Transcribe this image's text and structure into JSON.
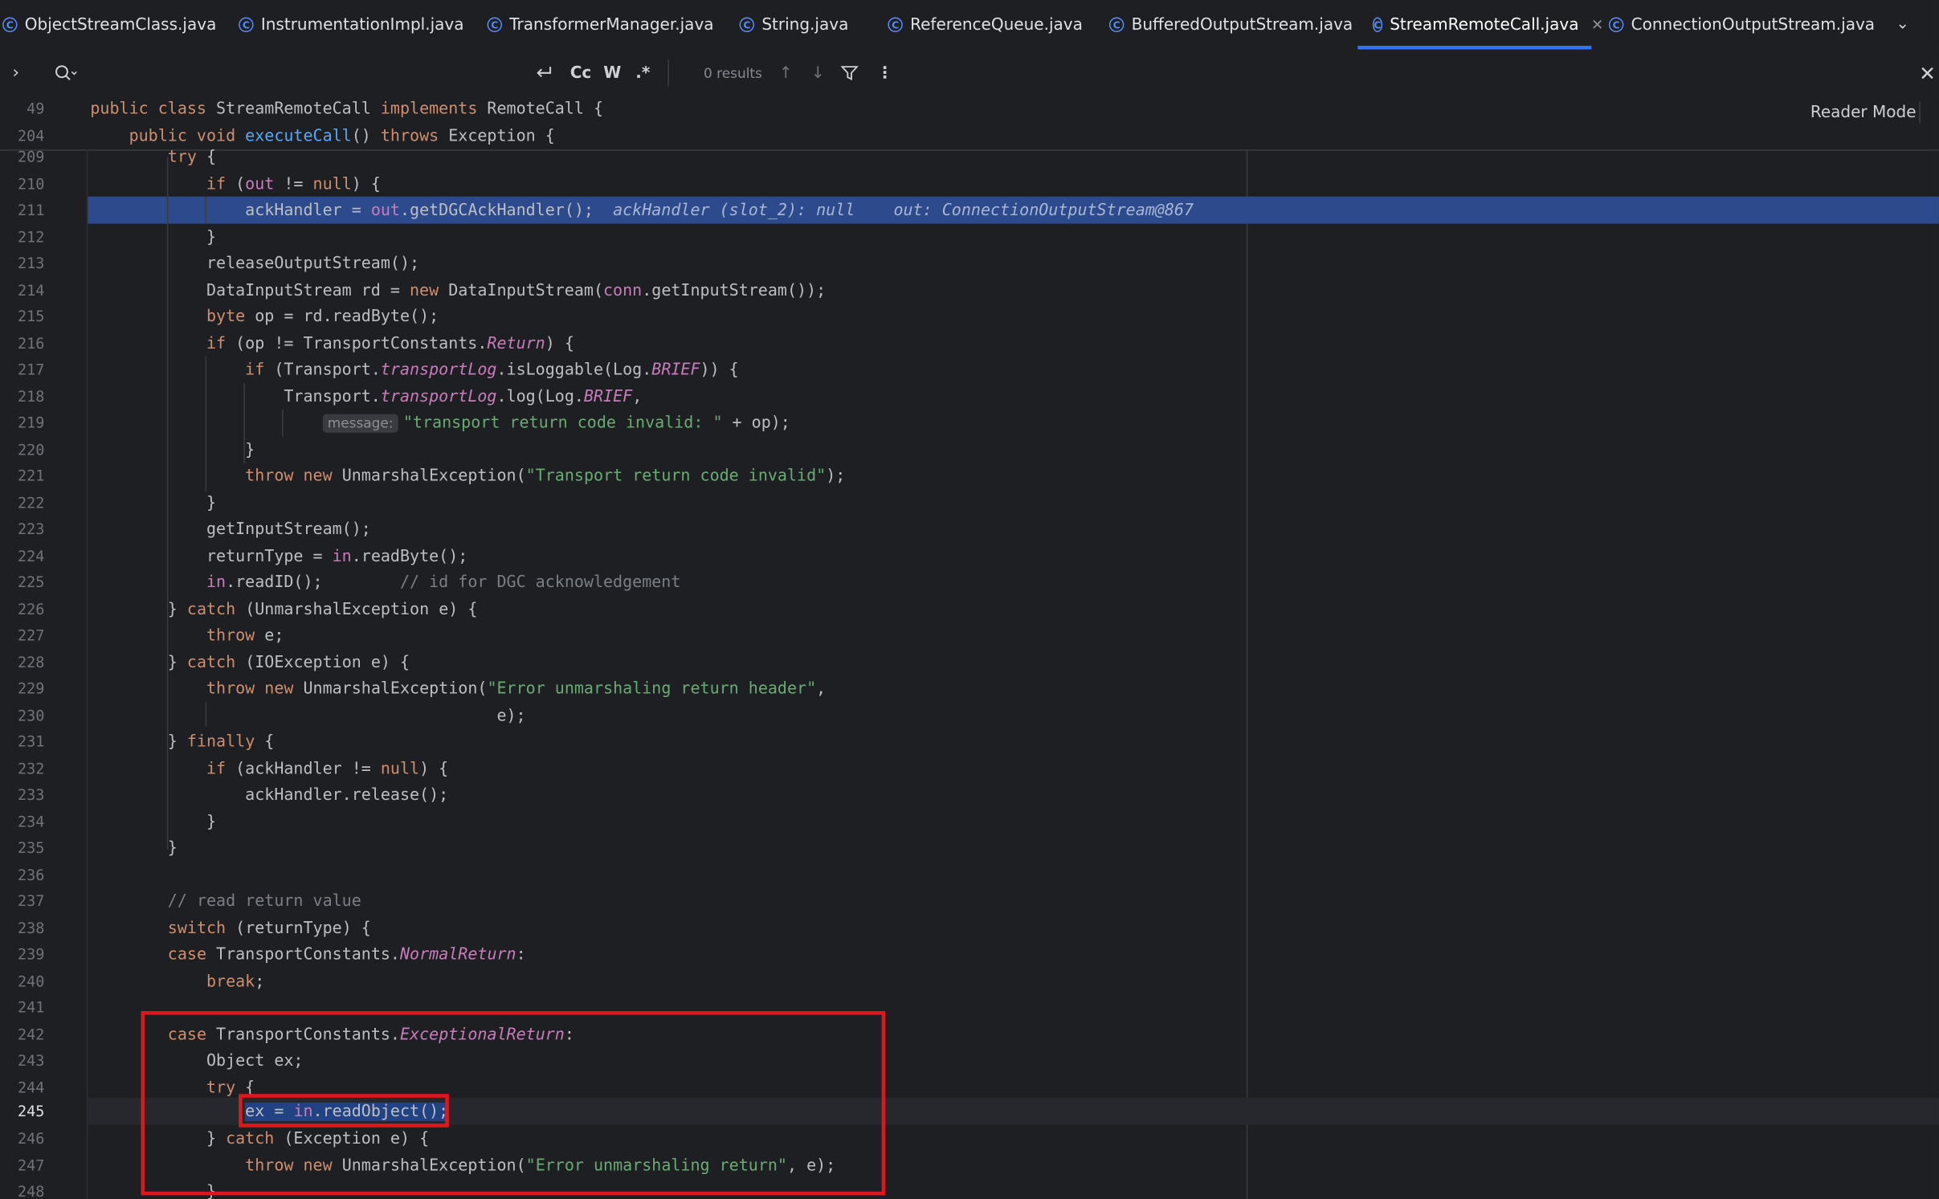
{
  "tabs": [
    {
      "label": "ObjectStreamClass.java",
      "icon": "class-icon"
    },
    {
      "label": "InstrumentationImpl.java",
      "icon": "class-icon"
    },
    {
      "label": "TransformerManager.java",
      "icon": "class-icon"
    },
    {
      "label": "String.java",
      "icon": "class-lock-icon"
    },
    {
      "label": "ReferenceQueue.java",
      "icon": "class-icon"
    },
    {
      "label": "BufferedOutputStream.java",
      "icon": "class-icon"
    },
    {
      "label": "StreamRemoteCall.java",
      "icon": "class-icon",
      "active": true
    },
    {
      "label": "ConnectionOutputStream.java",
      "icon": "class-icon"
    }
  ],
  "search": {
    "expand": "›",
    "results": "0 results",
    "match_case": "Cc",
    "words": "W",
    "regex": ".*"
  },
  "reader_mode": "Reader Mode",
  "sticky": [
    {
      "num": "49",
      "text": "public class StreamRemoteCall implements RemoteCall {"
    },
    {
      "num": "204",
      "text": "    public void executeCall() throws Exception {"
    }
  ],
  "line_numbers": [
    "209",
    "210",
    "211",
    "212",
    "213",
    "214",
    "215",
    "216",
    "217",
    "218",
    "219",
    "220",
    "221",
    "222",
    "223",
    "224",
    "225",
    "226",
    "227",
    "228",
    "229",
    "230",
    "231",
    "232",
    "233",
    "234",
    "235",
    "236",
    "237",
    "238",
    "239",
    "240",
    "241",
    "242",
    "243",
    "244",
    "245",
    "246",
    "247",
    "248"
  ],
  "debug_inline": {
    "ack": "ackHandler (slot_2): null",
    "out": "out: ConnectionOutputStream@867"
  },
  "param_hint": "message:",
  "colors": {
    "execution_line": "#2c4a8c",
    "highlight_box": "#e0161d",
    "tab_underline": "#3574f0"
  }
}
